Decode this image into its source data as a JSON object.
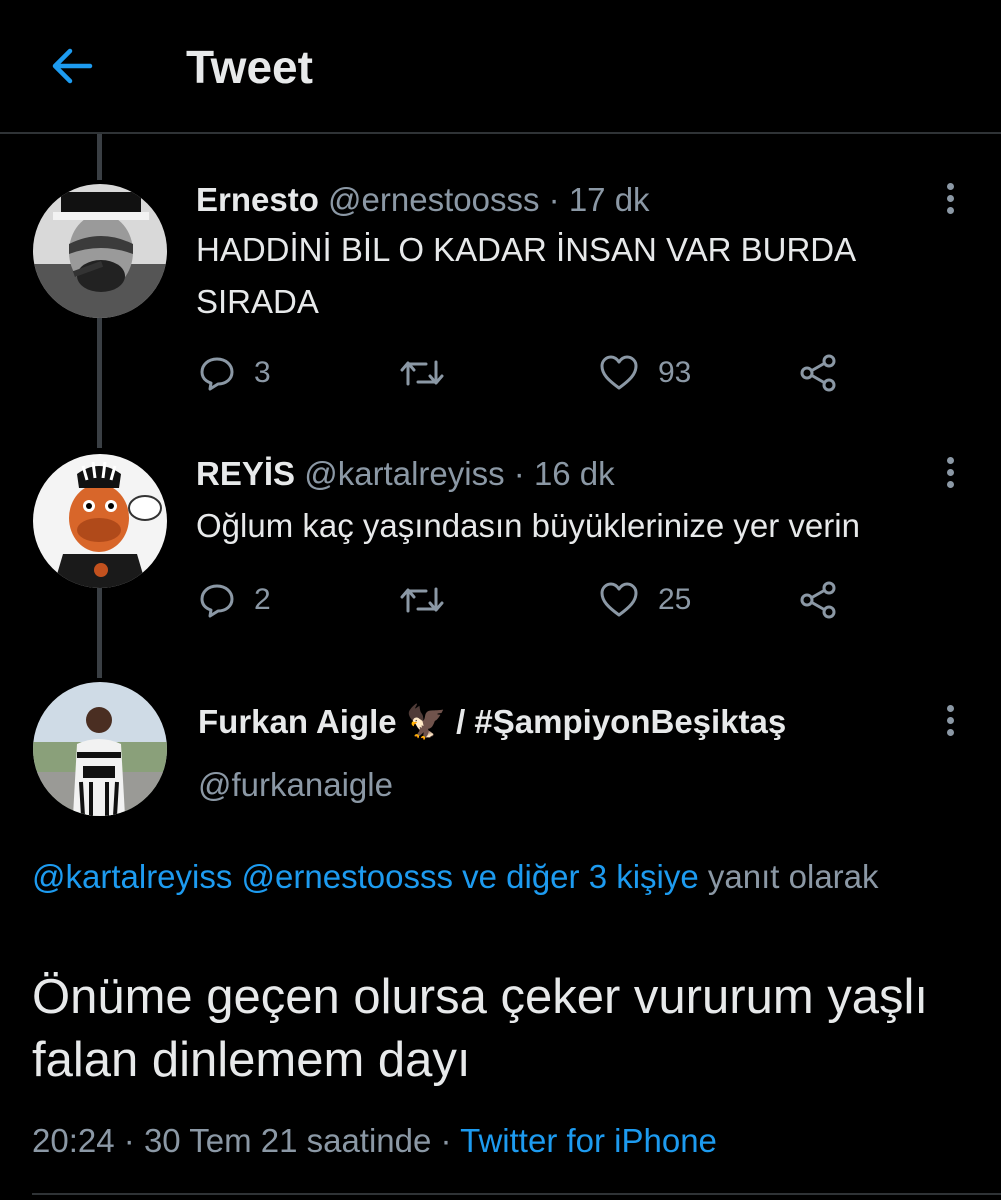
{
  "header": {
    "title": "Tweet",
    "back_icon": "arrow-left-icon",
    "accent": "#1d9bf0"
  },
  "replies": [
    {
      "name": "Ernesto",
      "handle": "@ernestoosss",
      "sep": "·",
      "time": "17 dk",
      "text": "HADDİNİ BİL O KADAR İNSAN VAR BURDA SIRADA",
      "replies_count": "3",
      "likes_count": "93"
    },
    {
      "name": "REYİS",
      "handle": "@kartalreyiss",
      "sep": "·",
      "time": "16 dk",
      "text": "Oğlum kaç yaşındasın büyüklerinize yer verin",
      "replies_count": "2",
      "likes_count": "25"
    }
  ],
  "main_tweet": {
    "name": "Furkan Aigle",
    "emoji": "🦅",
    "name_suffix": "/ #ŞampiyonBeşiktaş",
    "handle": "@furkanaigle",
    "reply_to_links": "@kartalreyiss @ernestoosss ve diğer 3 kişiye",
    "reply_to_suffix": "yanıt olarak",
    "text": "Önüme geçen olursa çeker vururum yaşlı falan dinlemem dayı",
    "time": "20:24",
    "sep1": "·",
    "date": "30 Tem 21 saatinde",
    "sep2": "·",
    "source": "Twitter for iPhone"
  },
  "colors": {
    "background": "#000000",
    "text": "#e7e9ea",
    "muted": "#8b98a5",
    "link": "#1d9bf0",
    "divider": "#2f3336"
  }
}
